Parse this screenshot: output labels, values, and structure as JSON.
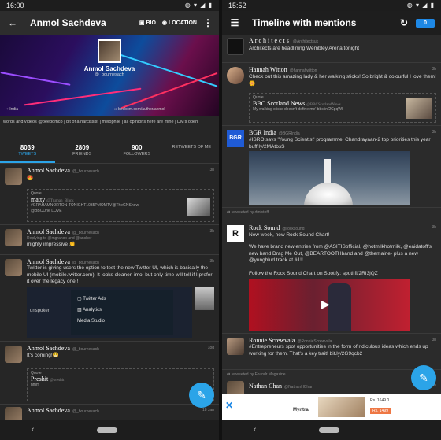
{
  "left": {
    "status": {
      "time": "16:00",
      "icons": "◍ ▾ ◢ ▮"
    },
    "appbar": {
      "title": "Anmol Sachdeva",
      "bio_label": "BIO",
      "location_label": "LOCATION"
    },
    "cover": {
      "name": "Anmol Sachdeva",
      "handle": "@_bournesach",
      "location": "India",
      "url": "beebom.com/author/anmol"
    },
    "bio": "words and videos @beebomco | bit of a narcissist | melophile | all opinions here are mine | DM's open",
    "stats": [
      {
        "n": "8039",
        "l": "TWEETS"
      },
      {
        "n": "2809",
        "l": "FRIENDS"
      },
      {
        "n": "900",
        "l": "FOLLOWERS"
      },
      {
        "n": "",
        "l": "RETWEETS OF ME"
      }
    ],
    "tweets": [
      {
        "name": "Anmol Sachdeva",
        "handle": "@_bournesach",
        "time": "3h",
        "text": "😍",
        "quote_label": "Quote",
        "quote_name": "matty",
        "quote_handle": "@Truman_Black",
        "quote_text": "#GRAHAMNORTON-TONIGHT1035PMOMTV@TheGNShow @BBCOne LOVE"
      },
      {
        "name": "Anmol Sachdeva",
        "handle": "@_bournesach",
        "time": "3h",
        "reply": "Replying to @mgranox and @anchor",
        "text": "mighty impressive 👏"
      },
      {
        "name": "Anmol Sachdeva",
        "handle": "@_bournesach",
        "time": "3h",
        "text": "Twitter is giving users the option to test the new Twitter UI, which is basically the mobile UI (mobile.twitter.com). It looks cleaner, imo, but only time will tell if I prefer it over the legacy one!!",
        "menu": [
          "Twitter Ads",
          "Analytics",
          "Media Studio"
        ],
        "side_label": "unspoken"
      },
      {
        "name": "Anmol Sachdeva",
        "handle": "@_bournesach",
        "time": "18d",
        "text": "It's coming!😬",
        "quote_label": "Quote",
        "quote_name": "Preshit",
        "quote_handle": "@preshit",
        "quote_text": "hmm"
      },
      {
        "name": "Anmol Sachdeva",
        "handle": "@_bournesach",
        "time": "18 Jan"
      }
    ]
  },
  "right": {
    "status": {
      "time": "15:52",
      "icons": "◍ ▾ ◢ ▮"
    },
    "appbar": {
      "title": "Timeline with mentions",
      "badge": "0"
    },
    "tweets": [
      {
        "name": "Architects",
        "handle": "@Architectsuk",
        "time": "",
        "text": "Architects are headlining Wembley Arena tonight"
      },
      {
        "name": "Hannah Witton",
        "handle": "@hannahwitton",
        "time": "3h",
        "text": "Check out this amazing lady & her walking sticks! So bright & colourful I love them! 🌼",
        "quote_label": "Quote",
        "quote_name": "BBC Scotland News",
        "quote_handle": "@BBCScotlandNews",
        "quote_text": "My walking sticks doesn't define me' bbc.in/2CpqWl"
      },
      {
        "name": "BGR India",
        "handle": "@BGRIndia",
        "time": "3h",
        "text": "#ISRO says 'Young Scientist' programme, Chandrayaan-2 top priorities this year buff.ly/2MAtbsS",
        "logo": "BGR"
      },
      {
        "retweeted": "retweeted by dmistoff",
        "name": "Rock Sound",
        "handle": "@rocksound",
        "time": "3h",
        "text": "New week, new Rock Sound Chart!",
        "text2": "We have brand new entries from @ASITISofficial, @hotmilkhotmilk, @eaidatoff's new band Drag Me Out, @BEARTOOTHband and @themaine- plus a new @yungblud track at #1!!",
        "text3": "Follow the Rock Sound Chart on Spotify: spoti.fi/2RI3jQZ",
        "logo": "R"
      },
      {
        "name": "Ronnie Screwvala",
        "handle": "@RonnieScrewvala",
        "time": "3h",
        "text": "#Entrepreneurs spot opportunities in the form of ridiculous ideas which ends up working for them. That's a key trait! bit.ly/2G9qcb2"
      },
      {
        "retweeted": "retweeted by Foundr Magazine",
        "name": "Nathan Chan",
        "handle": "@NathanHChan",
        "time": "3h"
      }
    ],
    "ad": {
      "brand": "Myntra",
      "price": "Rs. 1649.0",
      "price2": "Rs. 1499"
    }
  },
  "nav": {
    "back": "‹"
  }
}
